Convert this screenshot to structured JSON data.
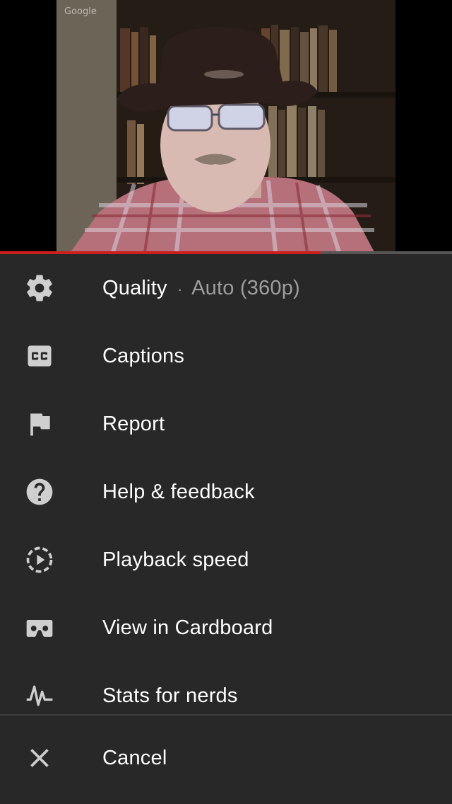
{
  "video": {
    "watermark": "Google",
    "progress_fraction": 0.71
  },
  "menu": {
    "items": [
      {
        "label": "Quality",
        "separator": "·",
        "value": "Auto (360p)",
        "icon": "gear-icon"
      },
      {
        "label": "Captions",
        "icon": "closed-captions-icon"
      },
      {
        "label": "Report",
        "icon": "flag-icon"
      },
      {
        "label": "Help & feedback",
        "icon": "help-icon"
      },
      {
        "label": "Playback speed",
        "icon": "playback-speed-icon"
      },
      {
        "label": "View in Cardboard",
        "icon": "cardboard-icon"
      },
      {
        "label": "Stats for nerds",
        "icon": "stats-pulse-icon"
      }
    ],
    "cancel": {
      "label": "Cancel",
      "icon": "close-icon"
    }
  },
  "colors": {
    "menu_bg": "#282828",
    "progress": "#cc1f1f",
    "text_primary": "#ffffff",
    "text_secondary": "#9e9e9e",
    "icon": "#cfcfcf"
  }
}
